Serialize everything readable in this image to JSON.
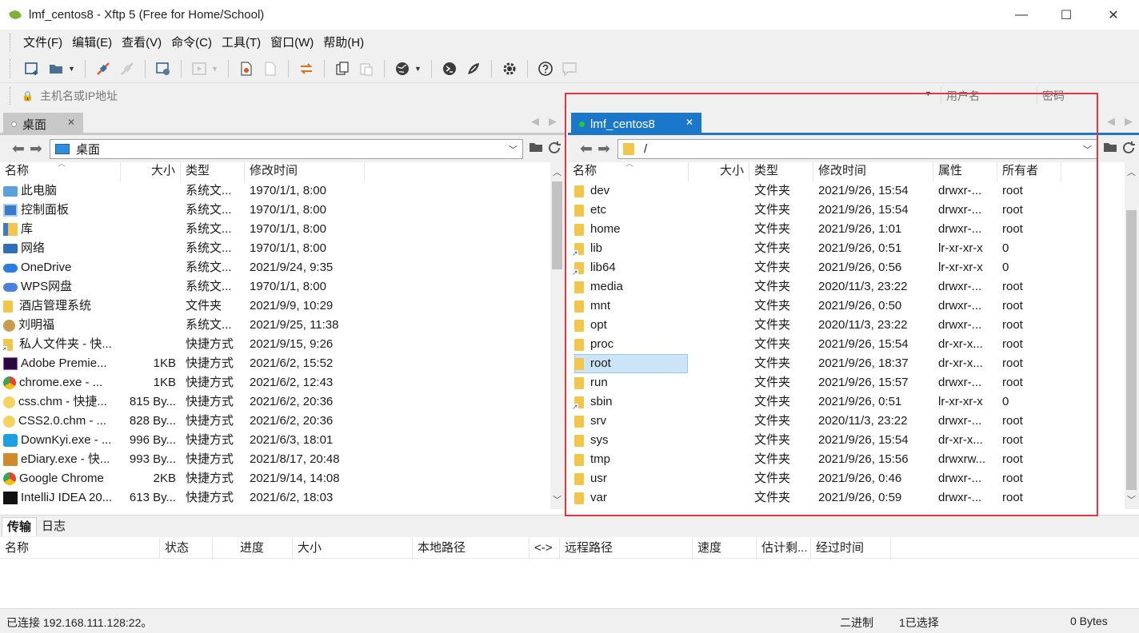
{
  "window": {
    "title": "lmf_centos8    - Xftp 5 (Free for Home/School)",
    "minimize_glyph": "—",
    "maximize_glyph": "☐",
    "close_glyph": "✕"
  },
  "menu": [
    "文件(F)",
    "编辑(E)",
    "查看(V)",
    "命令(C)",
    "工具(T)",
    "窗口(W)",
    "帮助(H)"
  ],
  "toolbar_icons": [
    "new-session-icon",
    "open-folder-icon",
    "connect-icon",
    "disconnect-icon",
    "session-properties-icon",
    "play-icon",
    "new-file-icon",
    "blank-file-icon",
    "sync-arrows-icon",
    "copy-icon",
    "paste-icon",
    "globe-icon",
    "xshell-icon",
    "xmanager-icon",
    "settings-icon",
    "help-icon",
    "chat-icon"
  ],
  "address": {
    "host_placeholder": "主机名或IP地址",
    "user_placeholder": "用户名",
    "password_placeholder": "密码"
  },
  "left_pane": {
    "tab_label": "桌面",
    "path": "桌面",
    "columns": [
      "名称",
      "大小",
      "类型",
      "修改时间"
    ],
    "scroll_position": 0.0,
    "rows": [
      {
        "icon": "pc",
        "name": "此电脑",
        "size": "",
        "type": "系统文...",
        "modified": "1970/1/1, 8:00"
      },
      {
        "icon": "ctrl",
        "name": "控制面板",
        "size": "",
        "type": "系统文...",
        "modified": "1970/1/1, 8:00"
      },
      {
        "icon": "lib",
        "name": "库",
        "size": "",
        "type": "系统文...",
        "modified": "1970/1/1, 8:00"
      },
      {
        "icon": "net",
        "name": "网络",
        "size": "",
        "type": "系统文...",
        "modified": "1970/1/1, 8:00"
      },
      {
        "icon": "cloud",
        "name": "OneDrive",
        "size": "",
        "type": "系统文...",
        "modified": "2021/9/24, 9:35"
      },
      {
        "icon": "wps",
        "name": "WPS网盘",
        "size": "",
        "type": "系统文...",
        "modified": "1970/1/1, 8:00"
      },
      {
        "icon": "folder",
        "name": "酒店管理系统",
        "size": "",
        "type": "文件夹",
        "modified": "2021/9/9, 10:29"
      },
      {
        "icon": "user",
        "name": "刘明福",
        "size": "",
        "type": "系统文...",
        "modified": "2021/9/25, 11:38"
      },
      {
        "icon": "folder-link",
        "name": "私人文件夹 - 快...",
        "size": "",
        "type": "快捷方式",
        "modified": "2021/9/15, 9:26"
      },
      {
        "icon": "adobe",
        "name": "Adobe Premie...",
        "size": "1KB",
        "type": "快捷方式",
        "modified": "2021/6/2, 15:52"
      },
      {
        "icon": "chrome",
        "name": "chrome.exe - ...",
        "size": "1KB",
        "type": "快捷方式",
        "modified": "2021/6/2, 12:43"
      },
      {
        "icon": "chm",
        "name": "css.chm - 快捷...",
        "size": "815 By...",
        "type": "快捷方式",
        "modified": "2021/6/2, 20:36"
      },
      {
        "icon": "chm",
        "name": "CSS2.0.chm - ...",
        "size": "828 By...",
        "type": "快捷方式",
        "modified": "2021/6/2, 20:36"
      },
      {
        "icon": "down",
        "name": "DownKyi.exe - ...",
        "size": "996 By...",
        "type": "快捷方式",
        "modified": "2021/6/3, 18:01"
      },
      {
        "icon": "diary",
        "name": "eDiary.exe - 快...",
        "size": "993 By...",
        "type": "快捷方式",
        "modified": "2021/8/17, 20:48"
      },
      {
        "icon": "chrome",
        "name": "Google Chrome",
        "size": "2KB",
        "type": "快捷方式",
        "modified": "2021/9/14, 14:08"
      },
      {
        "icon": "idea",
        "name": "IntelliJ IDEA 20...",
        "size": "613 By...",
        "type": "快捷方式",
        "modified": "2021/6/2, 18:03"
      }
    ]
  },
  "right_pane": {
    "tab_label": "lmf_centos8",
    "path": "/",
    "columns": [
      "名称",
      "大小",
      "类型",
      "修改时间",
      "属性",
      "所有者"
    ],
    "selected": "root",
    "rows": [
      {
        "link": false,
        "name": "dev",
        "size": "",
        "type": "文件夹",
        "modified": "2021/9/26, 15:54",
        "attr": "drwxr-...",
        "owner": "root"
      },
      {
        "link": false,
        "name": "etc",
        "size": "",
        "type": "文件夹",
        "modified": "2021/9/26, 15:54",
        "attr": "drwxr-...",
        "owner": "root"
      },
      {
        "link": false,
        "name": "home",
        "size": "",
        "type": "文件夹",
        "modified": "2021/9/26, 1:01",
        "attr": "drwxr-...",
        "owner": "root"
      },
      {
        "link": true,
        "name": "lib",
        "size": "",
        "type": "文件夹",
        "modified": "2021/9/26, 0:51",
        "attr": "lr-xr-xr-x",
        "owner": "0"
      },
      {
        "link": true,
        "name": "lib64",
        "size": "",
        "type": "文件夹",
        "modified": "2021/9/26, 0:56",
        "attr": "lr-xr-xr-x",
        "owner": "0"
      },
      {
        "link": false,
        "name": "media",
        "size": "",
        "type": "文件夹",
        "modified": "2020/11/3, 23:22",
        "attr": "drwxr-...",
        "owner": "root"
      },
      {
        "link": false,
        "name": "mnt",
        "size": "",
        "type": "文件夹",
        "modified": "2021/9/26, 0:50",
        "attr": "drwxr-...",
        "owner": "root"
      },
      {
        "link": false,
        "name": "opt",
        "size": "",
        "type": "文件夹",
        "modified": "2020/11/3, 23:22",
        "attr": "drwxr-...",
        "owner": "root"
      },
      {
        "link": false,
        "name": "proc",
        "size": "",
        "type": "文件夹",
        "modified": "2021/9/26, 15:54",
        "attr": "dr-xr-x...",
        "owner": "root"
      },
      {
        "link": false,
        "name": "root",
        "size": "",
        "type": "文件夹",
        "modified": "2021/9/26, 18:37",
        "attr": "dr-xr-x...",
        "owner": "root"
      },
      {
        "link": false,
        "name": "run",
        "size": "",
        "type": "文件夹",
        "modified": "2021/9/26, 15:57",
        "attr": "drwxr-...",
        "owner": "root"
      },
      {
        "link": true,
        "name": "sbin",
        "size": "",
        "type": "文件夹",
        "modified": "2021/9/26, 0:51",
        "attr": "lr-xr-xr-x",
        "owner": "0"
      },
      {
        "link": false,
        "name": "srv",
        "size": "",
        "type": "文件夹",
        "modified": "2020/11/3, 23:22",
        "attr": "drwxr-...",
        "owner": "root"
      },
      {
        "link": false,
        "name": "sys",
        "size": "",
        "type": "文件夹",
        "modified": "2021/9/26, 15:54",
        "attr": "dr-xr-x...",
        "owner": "root"
      },
      {
        "link": false,
        "name": "tmp",
        "size": "",
        "type": "文件夹",
        "modified": "2021/9/26, 15:56",
        "attr": "drwxrw...",
        "owner": "root"
      },
      {
        "link": false,
        "name": "usr",
        "size": "",
        "type": "文件夹",
        "modified": "2021/9/26, 0:46",
        "attr": "drwxr-...",
        "owner": "root"
      },
      {
        "link": false,
        "name": "var",
        "size": "",
        "type": "文件夹",
        "modified": "2021/9/26, 0:59",
        "attr": "drwxr-...",
        "owner": "root"
      }
    ]
  },
  "bottom": {
    "tabs": [
      "传输",
      "日志"
    ],
    "active_tab": "传输",
    "columns": [
      "名称",
      "状态",
      "进度",
      "大小",
      "本地路径",
      "<->",
      "远程路径",
      "速度",
      "估计剩...",
      "经过时间"
    ]
  },
  "status": {
    "connection": "已连接 192.168.111.128:22。",
    "mode": "二进制",
    "selection": "1已选择",
    "bytes": "0 Bytes"
  },
  "colors": {
    "active_tab": "#1a77c9",
    "selection": "#cce4f7",
    "highlight_box": "#e0383e",
    "folder": "#f2c64b"
  }
}
